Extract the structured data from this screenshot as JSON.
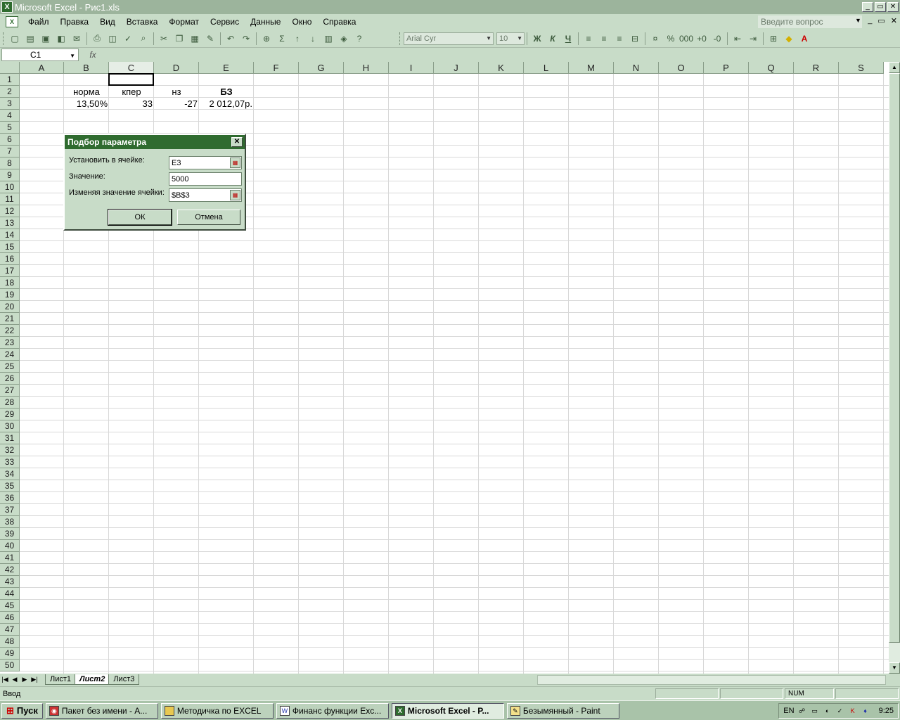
{
  "window": {
    "title": "Microsoft Excel - Рис1.xls",
    "min": "_",
    "max": "▭",
    "close": "✕"
  },
  "menu": [
    "Файл",
    "Правка",
    "Вид",
    "Вставка",
    "Формат",
    "Сервис",
    "Данные",
    "Окно",
    "Справка"
  ],
  "ask": {
    "placeholder": "Введите вопрос"
  },
  "toolbar": {
    "font": "Arial Cyr",
    "size": "10",
    "bold": "Ж",
    "italic": "К",
    "underline": "Ч"
  },
  "formula": {
    "name_box": "C1",
    "fx": "fx",
    "value": ""
  },
  "columns": [
    "A",
    "B",
    "C",
    "D",
    "E",
    "F",
    "G",
    "H",
    "I",
    "J",
    "K",
    "L",
    "M",
    "N",
    "O",
    "P",
    "Q",
    "R",
    "S"
  ],
  "rows": [
    "1",
    "2",
    "3",
    "4",
    "5",
    "6",
    "7",
    "8",
    "9",
    "10",
    "11",
    "12",
    "13",
    "14",
    "15",
    "16",
    "17",
    "18",
    "19",
    "20",
    "21",
    "22",
    "23",
    "24",
    "25",
    "26",
    "27",
    "28",
    "29",
    "30",
    "31",
    "32",
    "33",
    "34",
    "35",
    "36",
    "37",
    "38",
    "39",
    "40",
    "41",
    "42",
    "43",
    "44",
    "45",
    "46",
    "47",
    "48",
    "49",
    "50"
  ],
  "cells": {
    "B2": "норма",
    "C2": "кпер",
    "D2": "нз",
    "E2": "БЗ",
    "B3": "13,50%",
    "C3": "33",
    "D3": "-27",
    "E3": "2 012,07р."
  },
  "dialog": {
    "title": "Подбор параметра",
    "close": "✕",
    "set_cell_label": "Установить в ячейке:",
    "set_cell_value": "Е3",
    "value_label": "Значение:",
    "value_value": "5000",
    "changing_label": "Изменяя значение ячейки:",
    "changing_value": "$B$3",
    "ok": "ОК",
    "cancel": "Отмена"
  },
  "sheets": [
    "Лист1",
    "Лист2",
    "Лист3"
  ],
  "status": {
    "mode": "Ввод",
    "num": "NUM"
  },
  "taskbar": {
    "start": "Пуск",
    "tasks": [
      "Пакет без имени - A...",
      "Методичка по EXCEL",
      "Финанс функции Exc...",
      "Microsoft Excel - Р...",
      "Безымянный - Paint"
    ],
    "lang": "EN",
    "clock": "9:25"
  }
}
